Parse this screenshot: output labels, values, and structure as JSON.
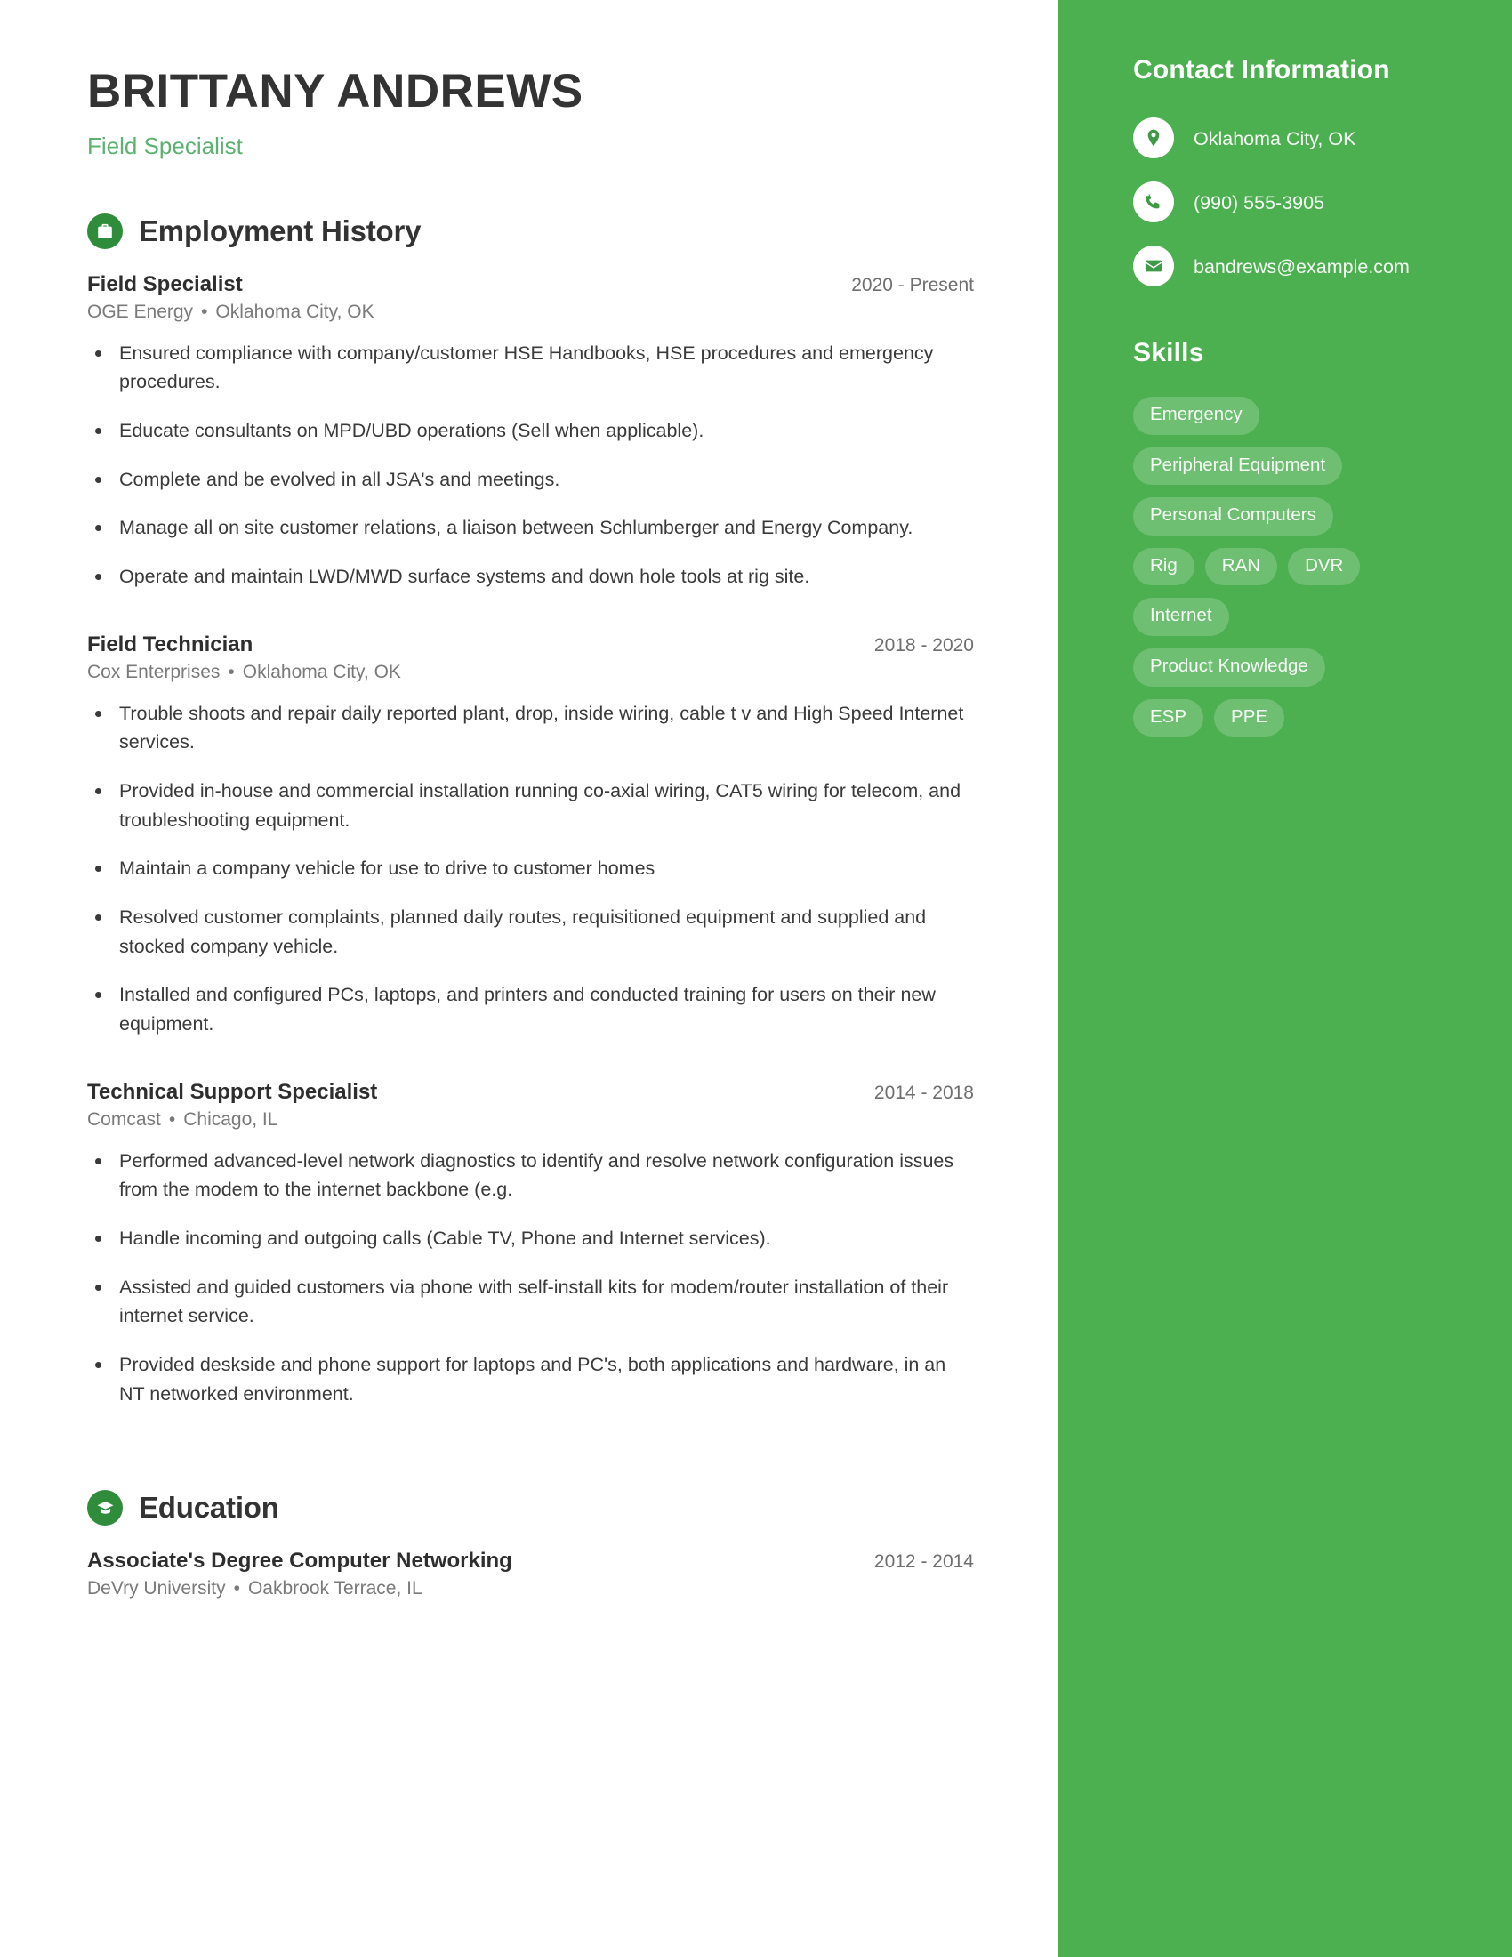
{
  "colors": {
    "sidebar_green": "#4caf50",
    "icon_green": "#2f8c3b",
    "accent_title_green": "#5cb270",
    "heading_dark": "#333333"
  },
  "header": {
    "name": "BRITTANY ANDREWS",
    "title": "Field Specialist"
  },
  "sections": {
    "employment": {
      "title": "Employment History",
      "icon": "briefcase-icon",
      "entries": [
        {
          "role": "Field Specialist",
          "dates": "2020 - Present",
          "company": "OGE Energy",
          "location": "Oklahoma City, OK",
          "separator": "•",
          "bullets": [
            "Ensured compliance with company/customer HSE Handbooks, HSE procedures and emergency procedures.",
            "Educate consultants on MPD/UBD operations (Sell when applicable).",
            "Complete and be evolved in all JSA's and meetings.",
            "Manage all on site customer relations, a liaison between Schlumberger and Energy Company.",
            "Operate and maintain LWD/MWD surface systems and down hole tools at rig site."
          ]
        },
        {
          "role": "Field Technician",
          "dates": "2018 - 2020",
          "company": "Cox Enterprises",
          "location": "Oklahoma City, OK",
          "separator": "•",
          "bullets": [
            "Trouble shoots and repair daily reported plant, drop, inside wiring, cable t v and High Speed Internet services.",
            "Provided in-house and commercial installation running co-axial wiring, CAT5 wiring for telecom, and troubleshooting equipment.",
            "Maintain a company vehicle for use to drive to customer homes",
            "Resolved customer complaints, planned daily routes, requisitioned equipment and supplied and stocked company vehicle.",
            "Installed and configured PCs, laptops, and printers and conducted training for users on their new equipment."
          ]
        },
        {
          "role": "Technical Support Specialist",
          "dates": "2014 - 2018",
          "company": "Comcast",
          "location": "Chicago, IL",
          "separator": "•",
          "bullets": [
            "Performed advanced-level network diagnostics to identify and resolve network configuration issues from the modem to the internet backbone (e.g.",
            "Handle incoming and outgoing calls (Cable TV, Phone and Internet services).",
            "Assisted and guided customers via phone with self-install kits for modem/router installation of their internet service.",
            "Provided deskside and phone support for laptops and PC's, both applications and hardware, in an NT networked environment."
          ]
        }
      ]
    },
    "education": {
      "title": "Education",
      "icon": "graduation-cap-icon",
      "entries": [
        {
          "role": "Associate's Degree Computer Networking",
          "dates": "2012 - 2014",
          "company": "DeVry University",
          "location": "Oakbrook Terrace, IL",
          "separator": "•"
        }
      ]
    }
  },
  "sidebar": {
    "contact": {
      "title": "Contact Information",
      "items": [
        {
          "icon": "location-pin-icon",
          "value": "Oklahoma City, OK"
        },
        {
          "icon": "phone-icon",
          "value": "(990) 555-3905"
        },
        {
          "icon": "email-icon",
          "value": "bandrews@example.com"
        }
      ]
    },
    "skills": {
      "title": "Skills",
      "items": [
        "Emergency",
        "Peripheral Equipment",
        "Personal Computers",
        "Rig",
        "RAN",
        "DVR",
        "Internet",
        "Product Knowledge",
        "ESP",
        "PPE"
      ]
    }
  }
}
